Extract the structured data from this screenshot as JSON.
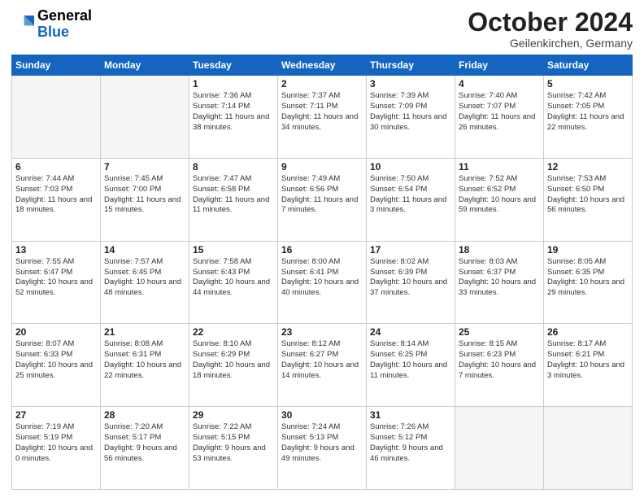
{
  "logo": {
    "line1": "General",
    "line2": "Blue"
  },
  "header": {
    "title": "October 2024",
    "subtitle": "Geilenkirchen, Germany"
  },
  "days_of_week": [
    "Sunday",
    "Monday",
    "Tuesday",
    "Wednesday",
    "Thursday",
    "Friday",
    "Saturday"
  ],
  "weeks": [
    [
      {
        "day": "",
        "info": ""
      },
      {
        "day": "",
        "info": ""
      },
      {
        "day": "1",
        "info": "Sunrise: 7:36 AM\nSunset: 7:14 PM\nDaylight: 11 hours and 38 minutes."
      },
      {
        "day": "2",
        "info": "Sunrise: 7:37 AM\nSunset: 7:11 PM\nDaylight: 11 hours and 34 minutes."
      },
      {
        "day": "3",
        "info": "Sunrise: 7:39 AM\nSunset: 7:09 PM\nDaylight: 11 hours and 30 minutes."
      },
      {
        "day": "4",
        "info": "Sunrise: 7:40 AM\nSunset: 7:07 PM\nDaylight: 11 hours and 26 minutes."
      },
      {
        "day": "5",
        "info": "Sunrise: 7:42 AM\nSunset: 7:05 PM\nDaylight: 11 hours and 22 minutes."
      }
    ],
    [
      {
        "day": "6",
        "info": "Sunrise: 7:44 AM\nSunset: 7:03 PM\nDaylight: 11 hours and 18 minutes."
      },
      {
        "day": "7",
        "info": "Sunrise: 7:45 AM\nSunset: 7:00 PM\nDaylight: 11 hours and 15 minutes."
      },
      {
        "day": "8",
        "info": "Sunrise: 7:47 AM\nSunset: 6:58 PM\nDaylight: 11 hours and 11 minutes."
      },
      {
        "day": "9",
        "info": "Sunrise: 7:49 AM\nSunset: 6:56 PM\nDaylight: 11 hours and 7 minutes."
      },
      {
        "day": "10",
        "info": "Sunrise: 7:50 AM\nSunset: 6:54 PM\nDaylight: 11 hours and 3 minutes."
      },
      {
        "day": "11",
        "info": "Sunrise: 7:52 AM\nSunset: 6:52 PM\nDaylight: 10 hours and 59 minutes."
      },
      {
        "day": "12",
        "info": "Sunrise: 7:53 AM\nSunset: 6:50 PM\nDaylight: 10 hours and 56 minutes."
      }
    ],
    [
      {
        "day": "13",
        "info": "Sunrise: 7:55 AM\nSunset: 6:47 PM\nDaylight: 10 hours and 52 minutes."
      },
      {
        "day": "14",
        "info": "Sunrise: 7:57 AM\nSunset: 6:45 PM\nDaylight: 10 hours and 48 minutes."
      },
      {
        "day": "15",
        "info": "Sunrise: 7:58 AM\nSunset: 6:43 PM\nDaylight: 10 hours and 44 minutes."
      },
      {
        "day": "16",
        "info": "Sunrise: 8:00 AM\nSunset: 6:41 PM\nDaylight: 10 hours and 40 minutes."
      },
      {
        "day": "17",
        "info": "Sunrise: 8:02 AM\nSunset: 6:39 PM\nDaylight: 10 hours and 37 minutes."
      },
      {
        "day": "18",
        "info": "Sunrise: 8:03 AM\nSunset: 6:37 PM\nDaylight: 10 hours and 33 minutes."
      },
      {
        "day": "19",
        "info": "Sunrise: 8:05 AM\nSunset: 6:35 PM\nDaylight: 10 hours and 29 minutes."
      }
    ],
    [
      {
        "day": "20",
        "info": "Sunrise: 8:07 AM\nSunset: 6:33 PM\nDaylight: 10 hours and 25 minutes."
      },
      {
        "day": "21",
        "info": "Sunrise: 8:08 AM\nSunset: 6:31 PM\nDaylight: 10 hours and 22 minutes."
      },
      {
        "day": "22",
        "info": "Sunrise: 8:10 AM\nSunset: 6:29 PM\nDaylight: 10 hours and 18 minutes."
      },
      {
        "day": "23",
        "info": "Sunrise: 8:12 AM\nSunset: 6:27 PM\nDaylight: 10 hours and 14 minutes."
      },
      {
        "day": "24",
        "info": "Sunrise: 8:14 AM\nSunset: 6:25 PM\nDaylight: 10 hours and 11 minutes."
      },
      {
        "day": "25",
        "info": "Sunrise: 8:15 AM\nSunset: 6:23 PM\nDaylight: 10 hours and 7 minutes."
      },
      {
        "day": "26",
        "info": "Sunrise: 8:17 AM\nSunset: 6:21 PM\nDaylight: 10 hours and 3 minutes."
      }
    ],
    [
      {
        "day": "27",
        "info": "Sunrise: 7:19 AM\nSunset: 5:19 PM\nDaylight: 10 hours and 0 minutes."
      },
      {
        "day": "28",
        "info": "Sunrise: 7:20 AM\nSunset: 5:17 PM\nDaylight: 9 hours and 56 minutes."
      },
      {
        "day": "29",
        "info": "Sunrise: 7:22 AM\nSunset: 5:15 PM\nDaylight: 9 hours and 53 minutes."
      },
      {
        "day": "30",
        "info": "Sunrise: 7:24 AM\nSunset: 5:13 PM\nDaylight: 9 hours and 49 minutes."
      },
      {
        "day": "31",
        "info": "Sunrise: 7:26 AM\nSunset: 5:12 PM\nDaylight: 9 hours and 46 minutes."
      },
      {
        "day": "",
        "info": ""
      },
      {
        "day": "",
        "info": ""
      }
    ]
  ]
}
